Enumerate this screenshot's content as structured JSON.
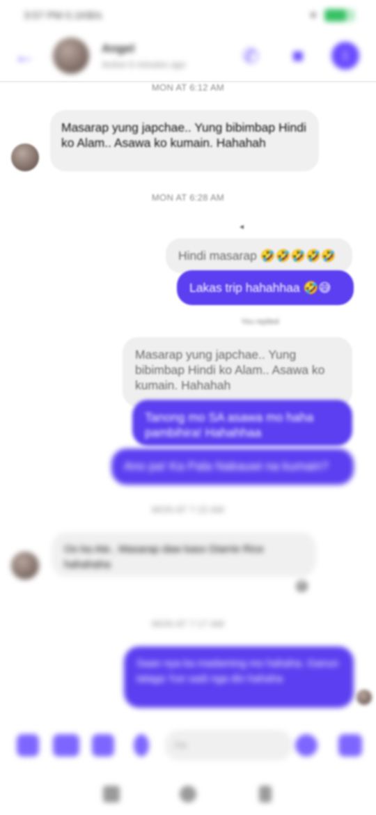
{
  "status": {
    "time": "3:57 PM 0.1KB/s",
    "battery": "47"
  },
  "header": {
    "name": "Angel",
    "subtitle": "Active 6 minutes ago",
    "accent": "#6c4cff"
  },
  "messages": {
    "ts1": "MON AT 6:12 AM",
    "in1": "Masarap yung japchae.. Yung bibimbap Hindi ko Alam.. Asawa ko kumain. Hahahah",
    "ts2": "MON AT 6:28 AM",
    "reply1": "Hindi masarap 🤣🤣🤣🤣🤣",
    "out1": "Lakas trip hahahhaa 🤣😅",
    "reply_note": "You replied",
    "reply2": "Masarap yung japchae.. Yung bibimbap Hindi ko Alam.. Asawa ko kumain. Hahahah",
    "out2": "Tanong mo SA asawa mo haha pambihira! Hahahhaa",
    "out3": "Ano pa! Ka Pala Nakauwi na kumain?",
    "ts3": "MON AT 7:15 AM",
    "in2": "Oo ka Ate.. Masarap daw kaso Diarrie Rice hahahaha",
    "in2_reaction": "😅",
    "ts4": "MON AT 7:17 AM",
    "out4": "Saan nya ka madaming mo hahaha. Ganun talaga Yun sadi nga din hahaha",
    "out_color": "#5b3ff0",
    "in_color": "#f0f0f0"
  },
  "composer": {
    "placeholder": "Aa",
    "send_icon": "thumbs-up-icon"
  }
}
